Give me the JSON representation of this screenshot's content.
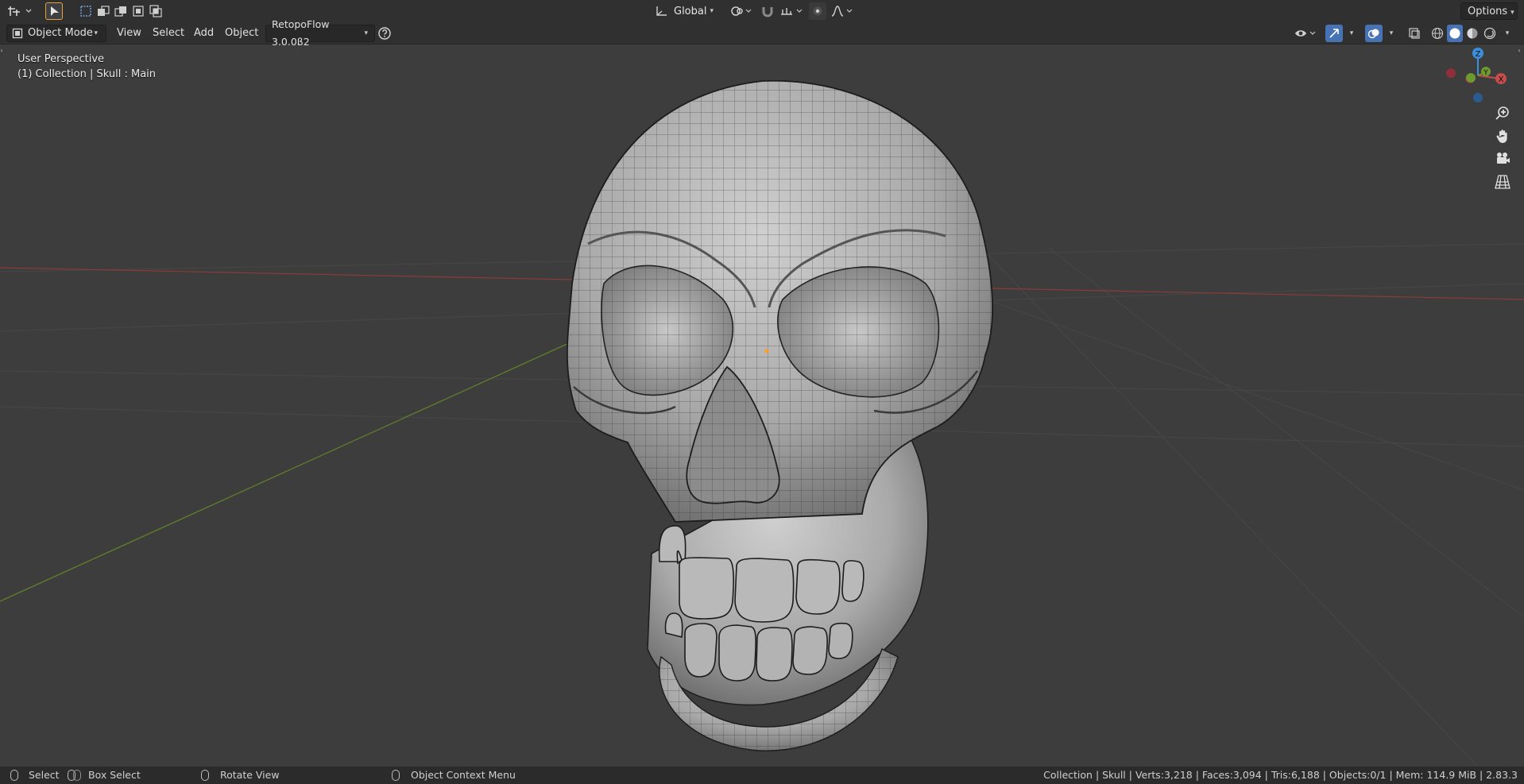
{
  "top_bar": {
    "orientation": "Global",
    "options_label": "Options"
  },
  "header": {
    "mode": "Object Mode",
    "menus": [
      "View",
      "Select",
      "Add",
      "Object"
    ],
    "addon": "RetopoFlow 3.0.0β2"
  },
  "viewport": {
    "perspective": "User Perspective",
    "collection_path": "(1) Collection | Skull : Main",
    "gizmo": {
      "z": "Z",
      "y": "Y",
      "x": "X"
    },
    "colors": {
      "x_axis": "#c44c4c",
      "y_axis": "#6f9a2f",
      "z_axis": "#3c8fdc",
      "background": "#3d3d3d"
    }
  },
  "status_bar": {
    "hints": [
      {
        "label": "Select",
        "icon": "mouse-left-icon"
      },
      {
        "label": "Box Select",
        "icon": "mouse-left-drag-icon"
      },
      {
        "label": "Rotate View",
        "icon": "mouse-middle-icon"
      },
      {
        "label": "Object Context Menu",
        "icon": "mouse-right-icon"
      }
    ],
    "stats": "Collection | Skull | Verts:3,218 | Faces:3,094 | Tris:6,188 | Objects:0/1 | Mem: 114.9 MiB | 2.83.3"
  }
}
